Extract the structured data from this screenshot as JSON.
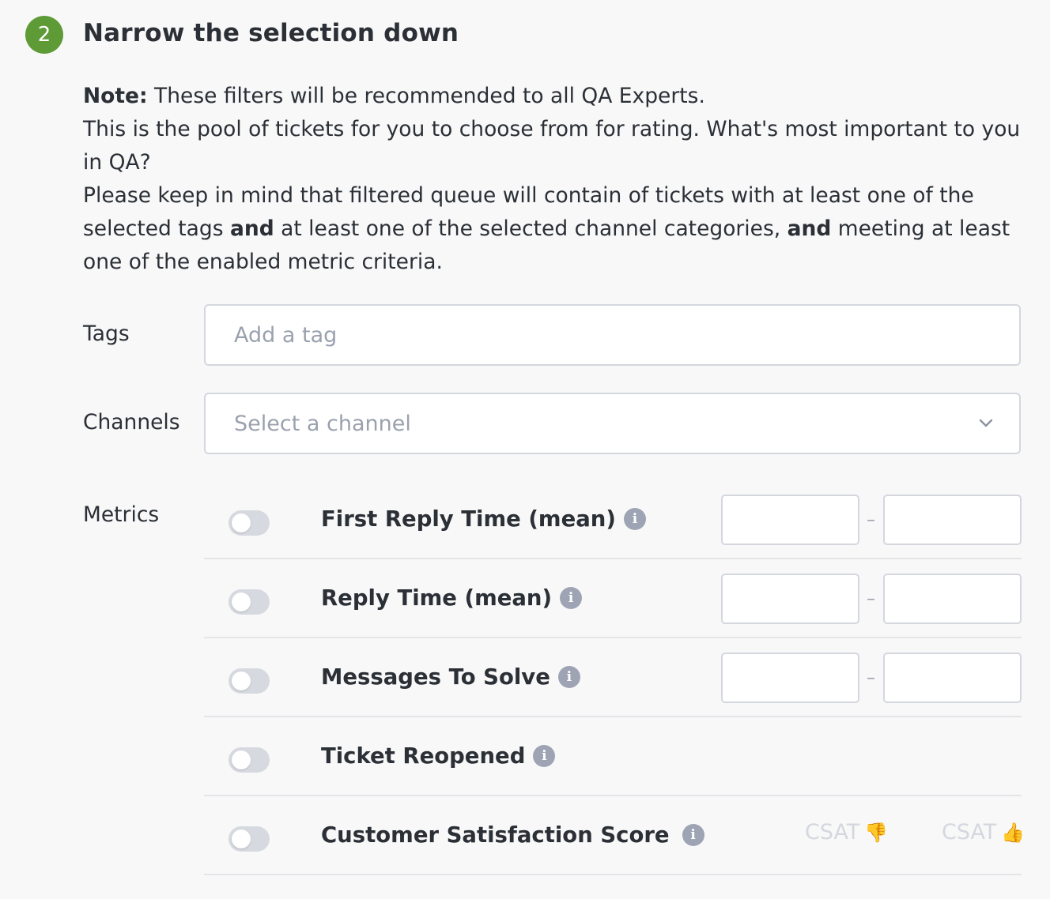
{
  "step": {
    "number": "2",
    "title": "Narrow the selection down"
  },
  "description": {
    "note_label": "Note:",
    "note_text": " These filters will be recommended to all QA Experts.",
    "line2": "This is the pool of tickets for you to choose from for rating. What's most important to you in QA?",
    "line3_part1": "Please keep in mind that filtered queue will contain of tickets with at least one of the selected tags ",
    "line3_and1": "and",
    "line3_part2": " at least one of the selected channel categories, ",
    "line3_and2": "and",
    "line3_part3": " meeting at least one of the enabled metric criteria."
  },
  "tags": {
    "label": "Tags",
    "placeholder": "Add a tag"
  },
  "channels": {
    "label": "Channels",
    "placeholder": "Select a channel"
  },
  "metrics": {
    "label": "Metrics",
    "items": [
      {
        "name": "First Reply Time (mean)",
        "enabled": false,
        "min": "",
        "max": ""
      },
      {
        "name": "Reply Time (mean)",
        "enabled": false,
        "min": "",
        "max": ""
      },
      {
        "name": "Messages To Solve",
        "enabled": false,
        "min": "",
        "max": ""
      },
      {
        "name": "Ticket Reopened",
        "enabled": false
      },
      {
        "name": "Customer Satisfaction Score",
        "enabled": false,
        "options": [
          "CSAT",
          "CSAT"
        ]
      }
    ],
    "range_separator": "–",
    "info_glyph": "i"
  },
  "icons": {
    "thumb_down": "👎",
    "thumb_up": "👍",
    "chevron": "chevron-down-icon"
  },
  "colors": {
    "step_badge": "#5e9b37",
    "toggle_off": "#d6d9df",
    "info_icon": "#9ea4b3",
    "placeholder": "#9aa1ae"
  }
}
